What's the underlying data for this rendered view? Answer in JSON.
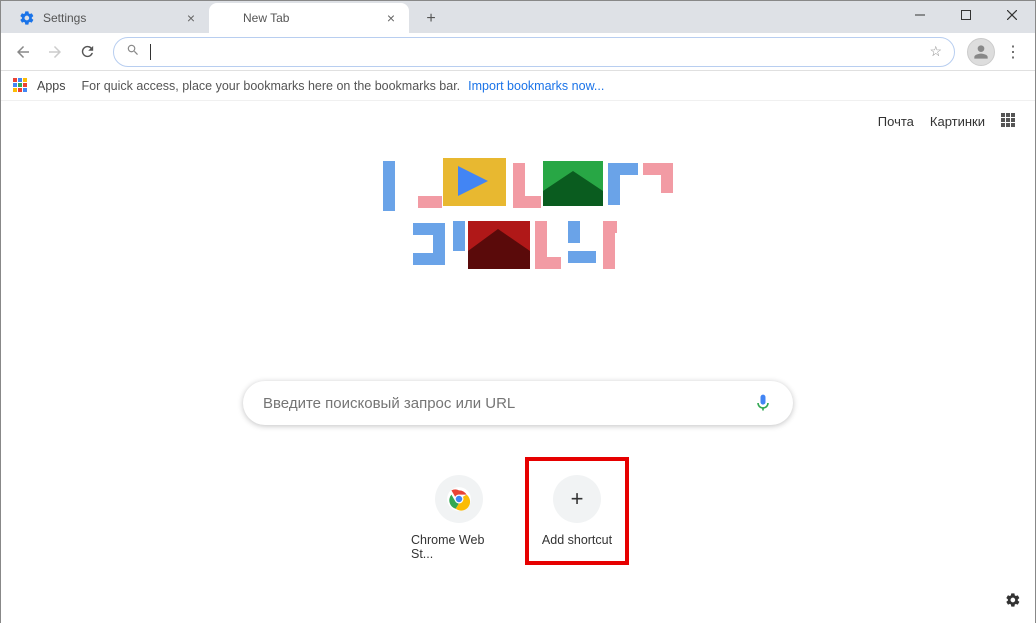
{
  "window": {
    "tabs": [
      {
        "title": "Settings",
        "active": false
      },
      {
        "title": "New Tab",
        "active": true
      }
    ]
  },
  "bookmarks_bar": {
    "apps_label": "Apps",
    "hint": "For quick access, place your bookmarks here on the bookmarks bar.",
    "import_link": "Import bookmarks now..."
  },
  "ntp": {
    "top_links": {
      "mail": "Почта",
      "images": "Картинки"
    },
    "search_placeholder": "Введите поисковый запрос или URL",
    "shortcuts": [
      {
        "label": "Chrome Web St..."
      },
      {
        "label": "Add shortcut"
      }
    ]
  }
}
